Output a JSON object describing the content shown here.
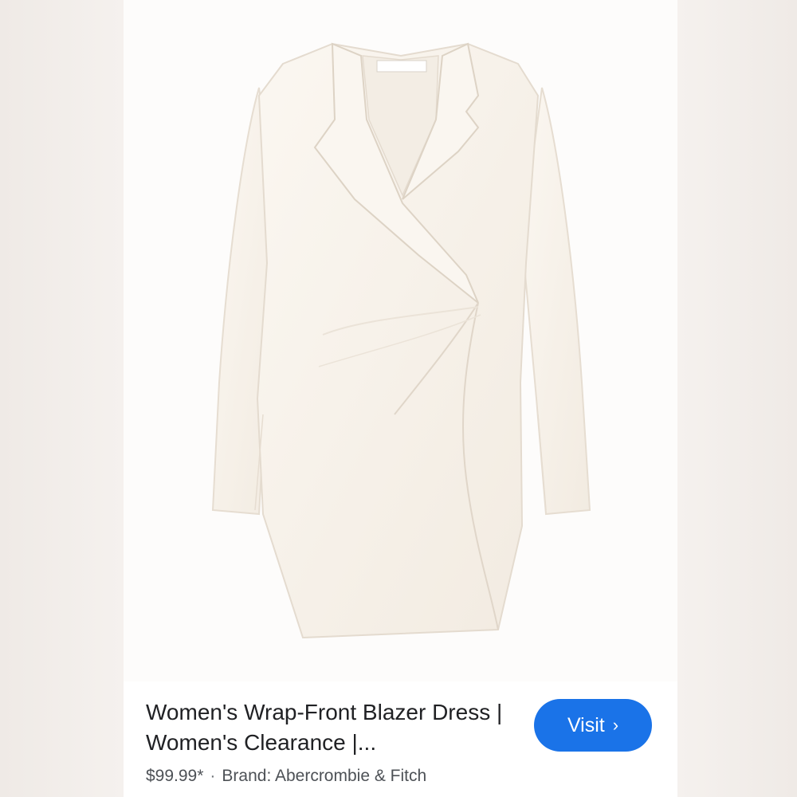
{
  "product": {
    "title": "Women's Wrap-Front Blazer Dress | Women's Clearance |...",
    "price": "$99.99*",
    "separator": "·",
    "brand": "Brand: Abercrombie & Fitch",
    "image_icon": "blazer-dress-image",
    "garment_color": "#f8f3ec"
  },
  "actions": {
    "visit_label": "Visit",
    "visit_icon": "chevron-right-icon",
    "visit_color": "#1a73e8"
  }
}
